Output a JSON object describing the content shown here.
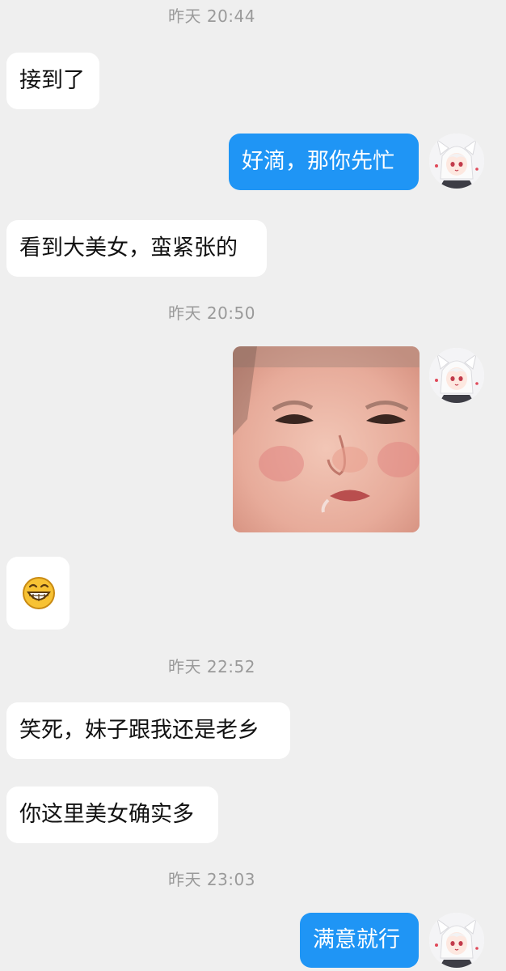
{
  "messages": {
    "t1": "昨天 20:44",
    "m1": "接到了",
    "m2": "好滴，那你先忙",
    "m3": "看到大美女，蛮紧张的",
    "t2": "昨天 20:50",
    "t3": "昨天 22:52",
    "m4": "笑死，妹子跟我还是老乡",
    "m5": "你这里美女确实多",
    "t4": "昨天 23:03",
    "m6": "满意就行"
  },
  "icons": {
    "emoji": "grinning-emoji-icon",
    "avatar": "anime-girl-avatar",
    "photo": "crying-baby-sticker"
  },
  "colors": {
    "background": "#efefef",
    "incoming_bubble": "#ffffff",
    "outgoing_bubble": "#1f95f5",
    "timestamp_text": "#9a9a9a"
  }
}
